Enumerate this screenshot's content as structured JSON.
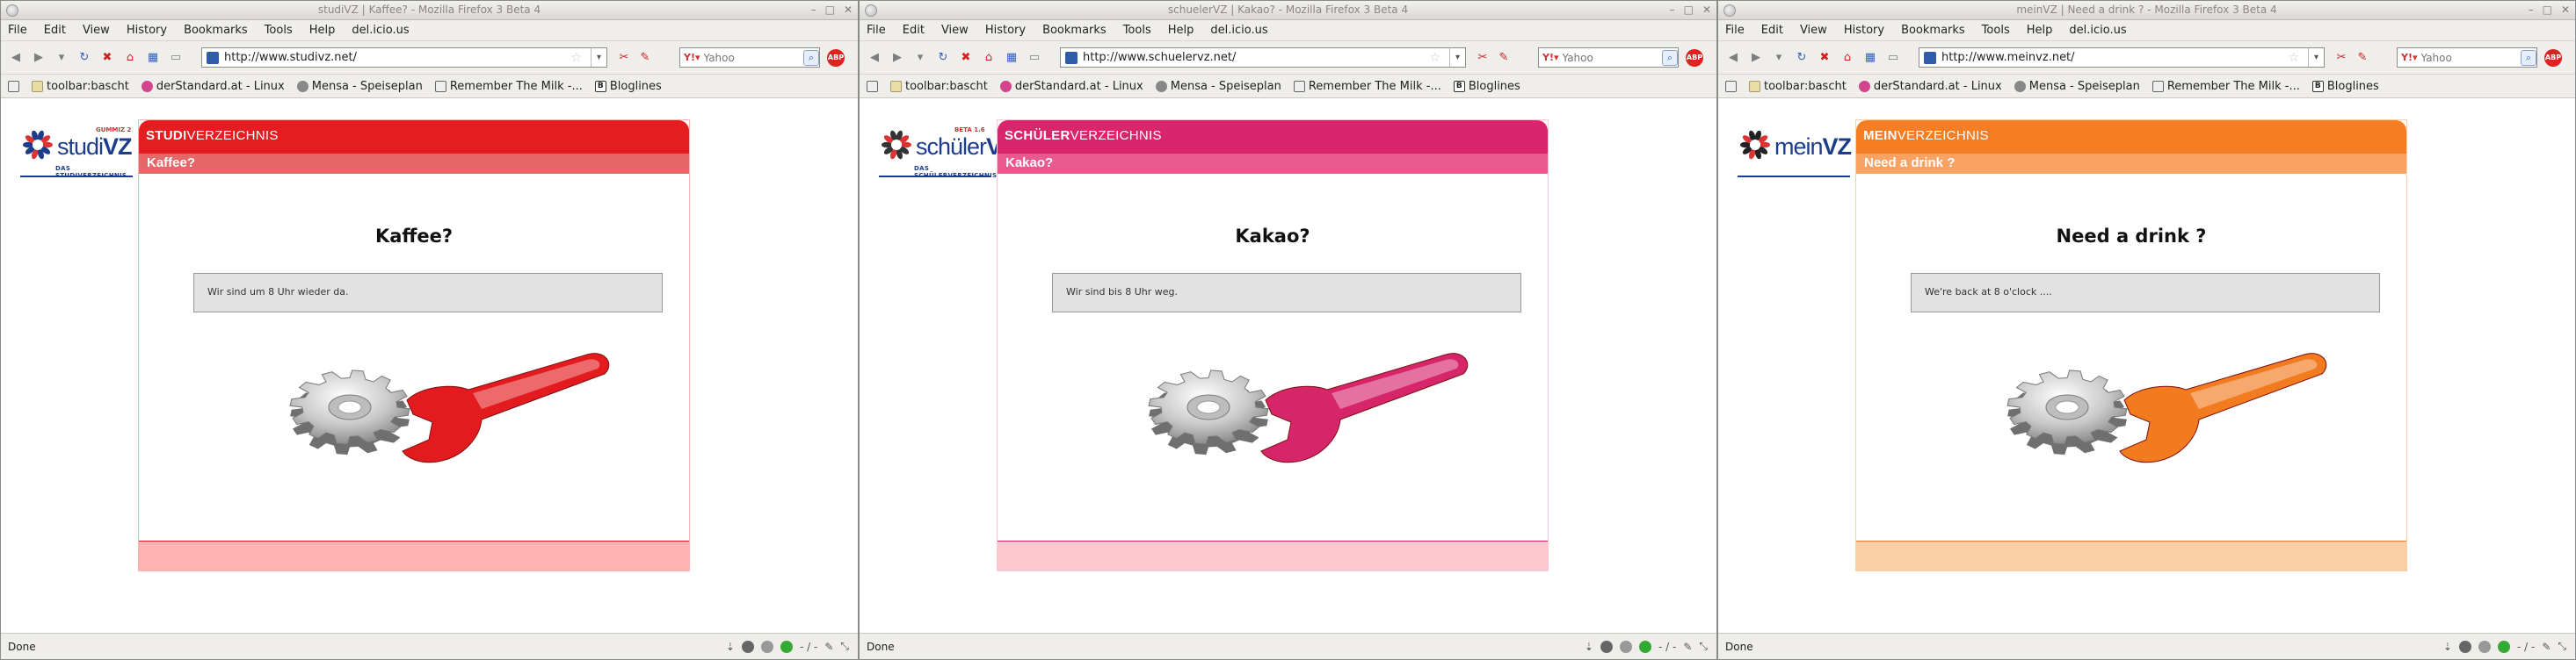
{
  "menu": [
    "File",
    "Edit",
    "View",
    "History",
    "Bookmarks",
    "Tools",
    "Help",
    "del.icio.us"
  ],
  "bookmarks": [
    "toolbar:bascht",
    "derStandard.at - Linux",
    "Mensa - Speiseplan",
    "Remember The Milk -...",
    "Bloglines"
  ],
  "search_placeholder": "Yahoo",
  "status_text": "Done",
  "status_counter": "- / -",
  "windows": [
    {
      "title": "studiVZ | Kaffee? - Mozilla Firefox 3 Beta 4",
      "url": "http://www.studivz.net/",
      "logo_main": "studi",
      "logo_vz": "VZ",
      "logo_sub": "DAS STUDIVERZEICHNIS",
      "logo_tag": "GUMMIZ 2",
      "header_strong": "STUDI",
      "header_rest": "VERZEICHNIS",
      "subheader": "Kaffee?",
      "heading": "Kaffee?",
      "message": "Wir sind um 8 Uhr wieder da.",
      "colors": {
        "primary": "#e51c20",
        "secondary": "#e66767",
        "footer": "#ffb3b3",
        "accent": "#e41b1e"
      }
    },
    {
      "title": "schuelerVZ | Kakao? - Mozilla Firefox 3 Beta 4",
      "url": "http://www.schuelervz.net/",
      "logo_main": "schüler",
      "logo_vz": "VZ",
      "logo_sub": "DAS SCHÜLERVERZEICHNIS",
      "logo_tag": "BETA 1.6",
      "header_strong": "SCHÜLER",
      "header_rest": "VERZEICHNIS",
      "subheader": "Kakao?",
      "heading": "Kakao?",
      "message": "Wir sind bis 8 Uhr weg.",
      "colors": {
        "primary": "#d9256c",
        "secondary": "#e85a8e",
        "footer": "#ffc7cf",
        "accent": "#d7256a"
      }
    },
    {
      "title": "meinVZ | Need a drink ? - Mozilla Firefox 3 Beta 4",
      "url": "http://www.meinvz.net/",
      "logo_main": "mein",
      "logo_vz": "VZ",
      "logo_sub": "",
      "logo_tag": "",
      "header_strong": "MEIN",
      "header_rest": "VERZEICHNIS",
      "subheader": "Need a drink ?",
      "heading": "Need a drink ?",
      "message": "We're back at 8 o'clock ....",
      "colors": {
        "primary": "#f57e24",
        "secondary": "#f8a263",
        "footer": "#fbcfa6",
        "accent": "#f27a1f"
      }
    }
  ]
}
